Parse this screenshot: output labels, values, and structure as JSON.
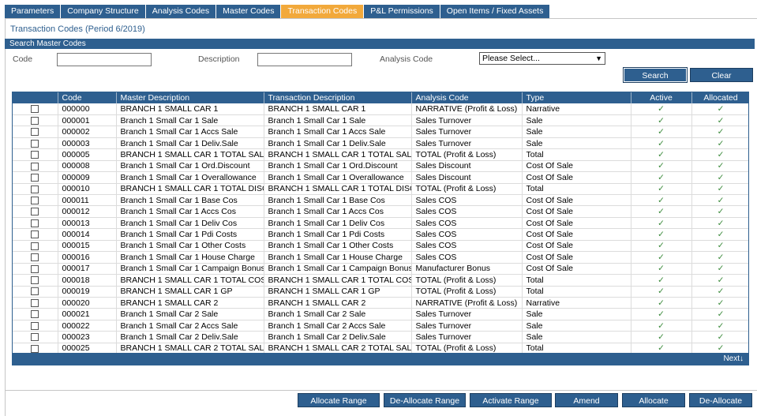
{
  "tabs": [
    {
      "label": "Parameters",
      "active": false
    },
    {
      "label": "Company Structure",
      "active": false
    },
    {
      "label": "Analysis Codes",
      "active": false
    },
    {
      "label": "Master Codes",
      "active": false
    },
    {
      "label": "Transaction Codes",
      "active": true
    },
    {
      "label": "P&L Permissions",
      "active": false
    },
    {
      "label": "Open Items / Fixed Assets",
      "active": false
    }
  ],
  "page_title": "Transaction Codes (Period 6/2019)",
  "search": {
    "section_title": "Search Master Codes",
    "code_label": "Code",
    "code_value": "",
    "description_label": "Description",
    "description_value": "",
    "analysis_label": "Analysis Code",
    "analysis_selected": "Please Select...",
    "search_button": "Search",
    "clear_button": "Clear"
  },
  "table": {
    "columns": [
      "",
      "Code",
      "Master Description",
      "Transaction Description",
      "Analysis Code",
      "Type",
      "Active",
      "Allocated"
    ],
    "rows": [
      [
        "000000",
        "BRANCH 1 SMALL CAR 1",
        "BRANCH 1 SMALL CAR 1",
        "NARRATIVE (Profit & Loss)",
        "Narrative"
      ],
      [
        "000001",
        "Branch 1 Small Car 1 Sale",
        "Branch 1 Small Car 1 Sale",
        "Sales Turnover",
        "Sale"
      ],
      [
        "000002",
        "Branch 1 Small Car 1 Accs Sale",
        "Branch 1 Small Car 1 Accs Sale",
        "Sales Turnover",
        "Sale"
      ],
      [
        "000003",
        "Branch 1 Small Car 1 Deliv.Sale",
        "Branch 1 Small Car 1 Deliv.Sale",
        "Sales Turnover",
        "Sale"
      ],
      [
        "000005",
        "BRANCH 1 SMALL CAR 1 TOTAL SALES",
        "BRANCH 1 SMALL CAR 1 TOTAL SALES",
        "TOTAL (Profit & Loss)",
        "Total"
      ],
      [
        "000008",
        "Branch 1 Small Car 1 Ord.Discount",
        "Branch 1 Small Car 1 Ord.Discount",
        "Sales Discount",
        "Cost Of Sale"
      ],
      [
        "000009",
        "Branch 1 Small Car 1 Overallowance",
        "Branch 1 Small Car 1 Overallowance",
        "Sales Discount",
        "Cost Of Sale"
      ],
      [
        "000010",
        "BRANCH 1 SMALL CAR 1 TOTAL DISC",
        "BRANCH 1 SMALL CAR 1 TOTAL DISC",
        "TOTAL (Profit & Loss)",
        "Total"
      ],
      [
        "000011",
        "Branch 1 Small Car 1 Base Cos",
        "Branch 1 Small Car 1 Base Cos",
        "Sales COS",
        "Cost Of Sale"
      ],
      [
        "000012",
        "Branch 1 Small Car 1 Accs Cos",
        "Branch 1 Small Car 1 Accs Cos",
        "Sales COS",
        "Cost Of Sale"
      ],
      [
        "000013",
        "Branch 1 Small Car 1 Deliv Cos",
        "Branch 1 Small Car 1 Deliv Cos",
        "Sales COS",
        "Cost Of Sale"
      ],
      [
        "000014",
        "Branch 1 Small Car 1 Pdi Costs",
        "Branch 1 Small Car 1 Pdi Costs",
        "Sales COS",
        "Cost Of Sale"
      ],
      [
        "000015",
        "Branch 1 Small Car 1 Other Costs",
        "Branch 1 Small Car 1 Other Costs",
        "Sales COS",
        "Cost Of Sale"
      ],
      [
        "000016",
        "Branch 1 Small Car 1 House Charge",
        "Branch 1 Small Car 1 House Charge",
        "Sales COS",
        "Cost Of Sale"
      ],
      [
        "000017",
        "Branch 1 Small Car 1 Campaign Bonus",
        "Branch 1 Small Car 1 Campaign Bonus",
        "Manufacturer Bonus",
        "Cost Of Sale"
      ],
      [
        "000018",
        "BRANCH 1 SMALL CAR 1 TOTAL COS",
        "BRANCH 1 SMALL CAR 1 TOTAL COS",
        "TOTAL (Profit & Loss)",
        "Total"
      ],
      [
        "000019",
        "BRANCH 1 SMALL CAR 1 GP",
        "BRANCH 1 SMALL CAR 1 GP",
        "TOTAL (Profit & Loss)",
        "Total"
      ],
      [
        "000020",
        "BRANCH 1 SMALL CAR 2",
        "BRANCH 1 SMALL CAR 2",
        "NARRATIVE (Profit & Loss)",
        "Narrative"
      ],
      [
        "000021",
        "Branch 1 Small Car 2 Sale",
        "Branch 1 Small Car 2 Sale",
        "Sales Turnover",
        "Sale"
      ],
      [
        "000022",
        "Branch 1 Small Car 2 Accs Sale",
        "Branch 1 Small Car 2 Accs Sale",
        "Sales Turnover",
        "Sale"
      ],
      [
        "000023",
        "Branch 1 Small Car 2 Deliv.Sale",
        "Branch 1 Small Car 2 Deliv.Sale",
        "Sales Turnover",
        "Sale"
      ],
      [
        "000025",
        "BRANCH 1 SMALL CAR 2 TOTAL SALES",
        "BRANCH 1 SMALL CAR 2 TOTAL SALES",
        "TOTAL (Profit & Loss)",
        "Total"
      ]
    ],
    "check_glyph": "✓",
    "next_label": "Next↓"
  },
  "actions": {
    "allocate_range": "Allocate Range",
    "deallocate_range": "De-Allocate Range",
    "activate_range": "Activate Range",
    "amend": "Amend",
    "allocate": "Allocate",
    "deallocate": "De-Allocate"
  },
  "colors": {
    "primary": "#2e5f8f",
    "active_tab": "#f2a93b",
    "check": "#3a8a3a"
  }
}
